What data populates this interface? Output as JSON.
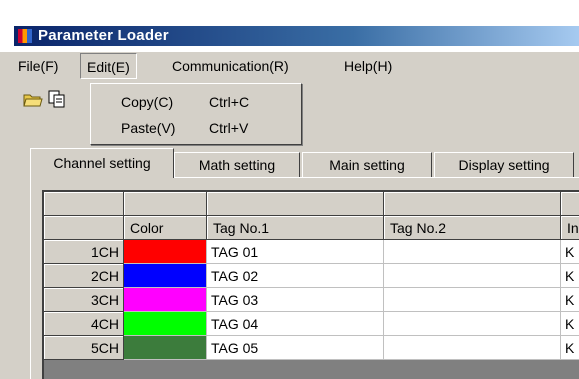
{
  "window": {
    "title": "Parameter Loader"
  },
  "menu": {
    "file": "File(F)",
    "edit": "Edit(E)",
    "communication": "Communication(R)",
    "help": "Help(H)"
  },
  "edit_menu": {
    "copy": {
      "label": "Copy(C)",
      "shortcut": "Ctrl+C"
    },
    "paste": {
      "label": "Paste(V)",
      "shortcut": "Ctrl+V"
    }
  },
  "toolbar": {
    "icons": [
      "open-folder-icon",
      "copy-icon"
    ]
  },
  "tabs": [
    {
      "label": "Channel setting",
      "selected": true
    },
    {
      "label": "Math setting",
      "selected": false
    },
    {
      "label": "Main setting",
      "selected": false
    },
    {
      "label": "Display setting",
      "selected": false
    }
  ],
  "grid": {
    "columns": [
      "Color",
      "Tag No.1",
      "Tag No.2",
      "In"
    ],
    "rows": [
      {
        "ch": "1CH",
        "color": "#ff0000",
        "tag1": "TAG 01",
        "tag2": "",
        "input": "K"
      },
      {
        "ch": "2CH",
        "color": "#0000ff",
        "tag1": "TAG 02",
        "tag2": "",
        "input": "K"
      },
      {
        "ch": "3CH",
        "color": "#ff00ff",
        "tag1": "TAG 03",
        "tag2": "",
        "input": "K"
      },
      {
        "ch": "4CH",
        "color": "#00ff00",
        "tag1": "TAG 04",
        "tag2": "",
        "input": "K"
      },
      {
        "ch": "5CH",
        "color": "#3c7c3c",
        "tag1": "TAG 05",
        "tag2": "",
        "input": "K"
      }
    ]
  }
}
